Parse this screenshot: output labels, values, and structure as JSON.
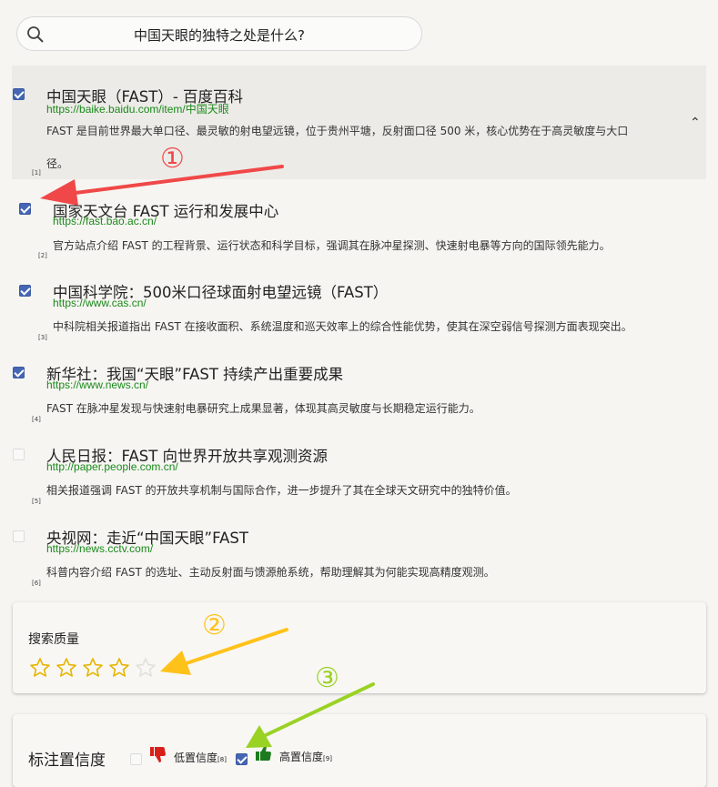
{
  "search": {
    "query": "中国天眼的独特之处是什么?"
  },
  "results": [
    {
      "title": "中国天眼（FAST）- 百度百科",
      "url": "https://baike.baidu.com/item/中国天眼",
      "desc_line1": "FAST 是目前世界最大单口径、最灵敏的射电望远镜，位于贵州平塘，反射面口径 500 米，核心优势在于高灵敏度与大口",
      "desc_line2": "径。",
      "num": "[1]",
      "checked": true
    },
    {
      "title": "国家天文台 FAST 运行和发展中心",
      "url": "https://fast.bao.ac.cn/",
      "desc": "官方站点介绍 FAST 的工程背景、运行状态和科学目标，强调其在脉冲星探测、快速射电暴等方向的国际领先能力。",
      "num": "[2]",
      "checked": true
    },
    {
      "title": "中国科学院：500米口径球面射电望远镜（FAST）",
      "url": "https://www.cas.cn/",
      "desc": "中科院相关报道指出 FAST 在接收面积、系统温度和巡天效率上的综合性能优势，使其在深空弱信号探测方面表现突出。",
      "num": "[3]",
      "checked": true
    },
    {
      "title": "新华社：我国“天眼”FAST 持续产出重要成果",
      "url": "https://www.news.cn/",
      "desc": "FAST 在脉冲星发现与快速射电暴研究上成果显著，体现其高灵敏度与长期稳定运行能力。",
      "num": "[4]",
      "checked": true
    },
    {
      "title": "人民日报：FAST 向世界开放共享观测资源",
      "url": "http://paper.people.com.cn/",
      "desc": "相关报道强调 FAST 的开放共享机制与国际合作，进一步提升了其在全球天文研究中的独特价值。",
      "num": "[5]",
      "checked": false
    },
    {
      "title": "央视网：走近“中国天眼”FAST",
      "url": "https://news.cctv.com/",
      "desc": "科普内容介绍 FAST 的选址、主动反射面与馈源舱系统，帮助理解其为何能实现高精度观测。",
      "num": "[6]",
      "checked": false
    }
  ],
  "quality": {
    "title": "搜索质量",
    "rating": 4,
    "max": 5
  },
  "confidence": {
    "title": "标注置信度",
    "low_label": "低置信度",
    "low_num": "[8]",
    "low_checked": false,
    "high_label": "高置信度",
    "high_num": "[9]",
    "high_checked": true
  },
  "annotations": {
    "one": "①",
    "two": "②",
    "three": "③"
  },
  "colors": {
    "accent": "#4466b4",
    "url": "#1a8a1a",
    "thumb_down": "#d8201a",
    "thumb_up": "#1e7a1e",
    "arrow_red": "#f04848",
    "arrow_yellow": "#ffc21a",
    "arrow_green": "#9ad224"
  }
}
